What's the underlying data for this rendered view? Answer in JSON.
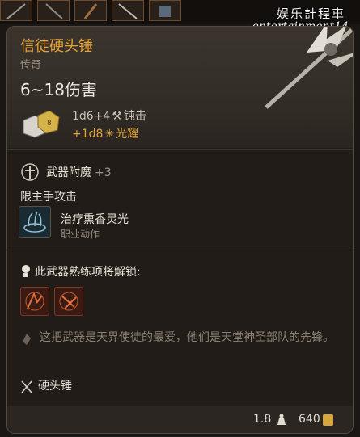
{
  "watermark": {
    "line1": "娱乐計程車",
    "line2": "entertainment14"
  },
  "item": {
    "name": "信徒硬头锤",
    "rarity": "传奇",
    "damage_range": "6~18伤害",
    "damage_base": "1d6+4",
    "damage_base_type": "钝击",
    "damage_bonus": "+1d8",
    "damage_bonus_type": "光耀"
  },
  "enchant": {
    "label": "武器附魔",
    "bonus": "+3"
  },
  "mainhand": {
    "label": "限主手攻击"
  },
  "action": {
    "name": "治疗熏香灵光",
    "type": "职业动作"
  },
  "mastery": {
    "label": "此武器熟练项将解锁:"
  },
  "flavor": "这把武器是天界使徒的最爱，他们是天堂神圣部队的先锋。",
  "weapon_type": "硬头锤",
  "footer": {
    "weight": "1.8",
    "price": "640"
  },
  "icons": {
    "blunt": "hammer-icon",
    "radiant": "radiant-icon",
    "enchant": "enchant-icon",
    "mastery": "bulb-icon",
    "flavor": "quote-icon",
    "type": "crossed-weapons-icon",
    "weight": "weight-icon",
    "coin": "gold-coin-icon"
  },
  "colors": {
    "name": "#e8a33a",
    "radiant": "#e0a43c"
  }
}
